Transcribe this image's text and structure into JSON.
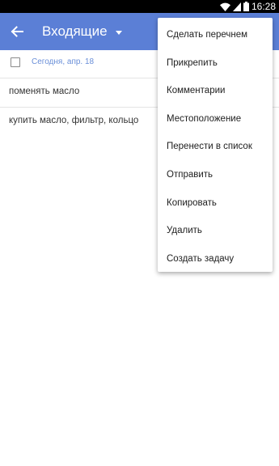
{
  "status_bar": {
    "time": "16:28",
    "icons": [
      "wifi-icon",
      "signal-icon",
      "battery-icon"
    ]
  },
  "app_bar": {
    "title": "Входящие",
    "back_icon": "arrow-left-icon",
    "color": "#5b7fd6"
  },
  "list": {
    "date_header": "Сегодня, апр. 18",
    "tasks": [
      {
        "text": "поменять масло"
      },
      {
        "text": "купить масло, фильтр, кольцо"
      }
    ]
  },
  "menu": {
    "items": [
      {
        "label": "Сделать перечнем"
      },
      {
        "label": "Прикрепить"
      },
      {
        "label": "Комментарии"
      },
      {
        "label": "Местоположение"
      },
      {
        "label": "Перенести в список"
      },
      {
        "label": "Отправить"
      },
      {
        "label": "Копировать"
      },
      {
        "label": "Удалить"
      },
      {
        "label": "Создать задачу"
      }
    ]
  }
}
